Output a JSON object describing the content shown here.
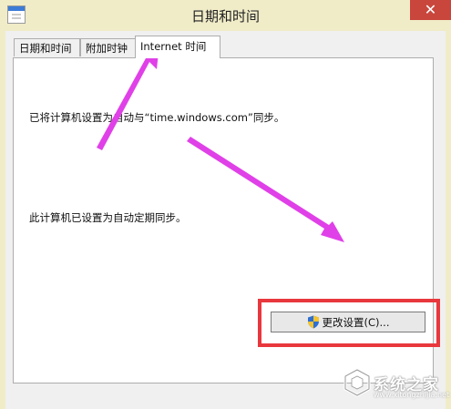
{
  "window": {
    "title": "日期和时间",
    "close_label": "✕",
    "icons": {
      "app": "calendar-icon",
      "close": "close-icon"
    },
    "colors": {
      "titlebar": "#f0ecc8",
      "close": "#c9463d",
      "client": "#f0f0f0"
    }
  },
  "tabs": [
    {
      "label": "日期和时间",
      "active": false
    },
    {
      "label": "附加时钟",
      "active": false
    },
    {
      "label": "Internet 时间",
      "active": true
    }
  ],
  "panel": {
    "sync_message": "已将计算机设置为自动与“time.windows.com”同步。",
    "schedule_message": "此计算机已设置为自动定期同步。",
    "change_button_label": "更改设置(C)...",
    "change_button_icon": "uac-shield-icon"
  },
  "annotations": {
    "arrow_color": "#e040e8",
    "highlight_color": "#e8383d"
  },
  "watermark": {
    "text": "系统之家",
    "url": "www.xitongzhijia.net",
    "logo_icon": "xitongzhijia-logo-icon"
  }
}
